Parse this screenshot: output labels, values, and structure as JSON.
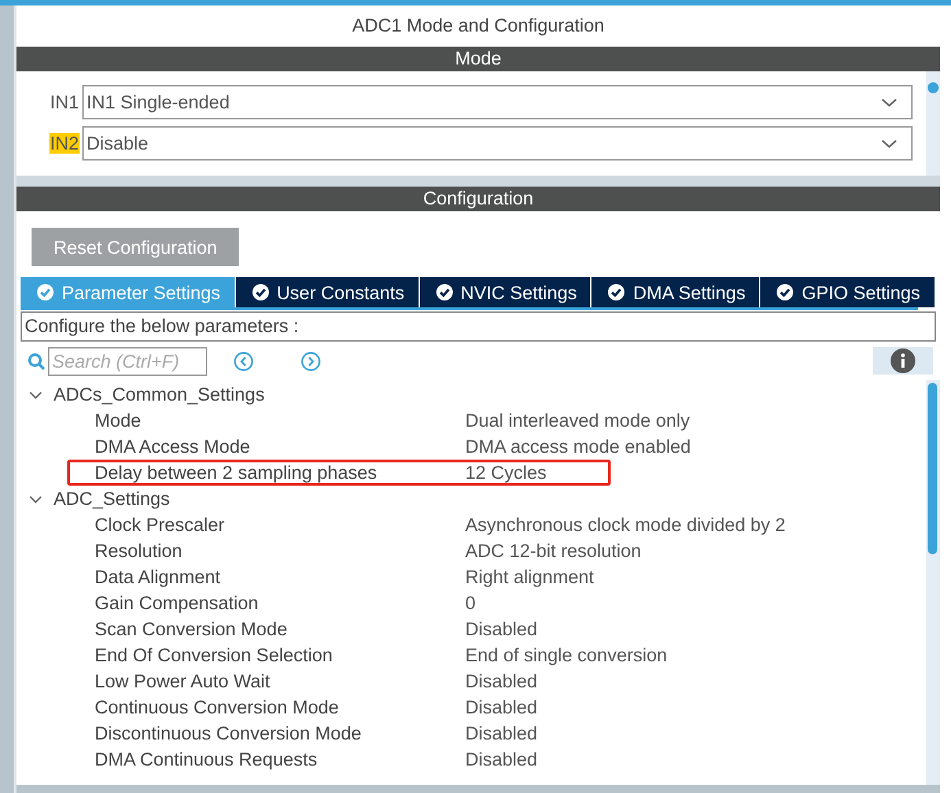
{
  "window": {
    "title": "ADC1 Mode and Configuration"
  },
  "mode": {
    "header": "Mode",
    "fields": [
      {
        "label": "IN1",
        "value": "IN1 Single-ended",
        "highlighted": false
      },
      {
        "label": "IN2",
        "value": "Disable",
        "highlighted": true
      }
    ]
  },
  "configuration": {
    "header": "Configuration",
    "reset_button": "Reset Configuration",
    "tabs": [
      {
        "label": "Parameter Settings",
        "selected": true
      },
      {
        "label": "User Constants",
        "selected": false
      },
      {
        "label": "NVIC Settings",
        "selected": false
      },
      {
        "label": "DMA Settings",
        "selected": false
      },
      {
        "label": "GPIO Settings",
        "selected": false
      }
    ],
    "description": "Configure the below parameters :",
    "search": {
      "placeholder": "Search (Ctrl+F)"
    },
    "tree": [
      {
        "label": "ADCs_Common_Settings",
        "expanded": true,
        "children": [
          {
            "label": "Mode",
            "value": "Dual interleaved mode only",
            "highlighted": false
          },
          {
            "label": "DMA Access Mode",
            "value": "DMA access mode enabled",
            "highlighted": false
          },
          {
            "label": "Delay between 2 sampling phases",
            "value": "12 Cycles",
            "highlighted": true
          }
        ]
      },
      {
        "label": "ADC_Settings",
        "expanded": true,
        "children": [
          {
            "label": "Clock Prescaler",
            "value": "Asynchronous clock mode divided by 2",
            "highlighted": false
          },
          {
            "label": "Resolution",
            "value": "ADC 12-bit resolution",
            "highlighted": false
          },
          {
            "label": "Data Alignment",
            "value": "Right alignment",
            "highlighted": false
          },
          {
            "label": "Gain Compensation",
            "value": "0",
            "highlighted": false
          },
          {
            "label": "Scan Conversion Mode",
            "value": "Disabled",
            "highlighted": false
          },
          {
            "label": "End Of Conversion Selection",
            "value": "End of single conversion",
            "highlighted": false
          },
          {
            "label": "Low Power Auto Wait",
            "value": "Disabled",
            "highlighted": false
          },
          {
            "label": "Continuous Conversion Mode",
            "value": "Disabled",
            "highlighted": false
          },
          {
            "label": "Discontinuous Conversion Mode",
            "value": "Disabled",
            "highlighted": false
          },
          {
            "label": "DMA Continuous Requests",
            "value": "Disabled",
            "highlighted": false
          }
        ]
      }
    ]
  }
}
